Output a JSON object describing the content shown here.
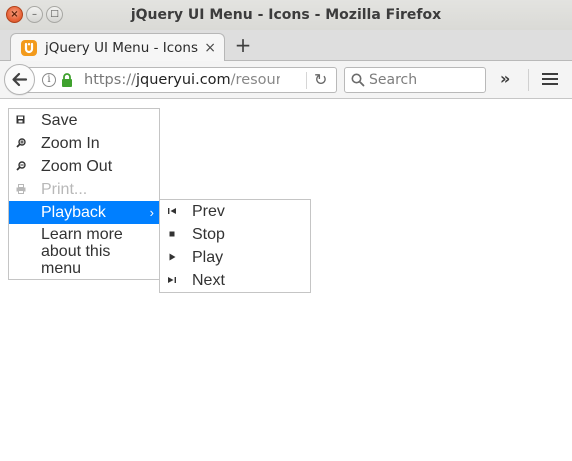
{
  "window": {
    "title": "jQuery UI Menu - Icons - Mozilla Firefox",
    "controls": {
      "close": "×",
      "minimize": "–",
      "maximize": "□"
    }
  },
  "tabs": [
    {
      "title": "jQuery UI Menu - Icons",
      "close": "×",
      "favicon": "jquery-ui-icon"
    }
  ],
  "new_tab": "+",
  "navbar": {
    "url_scheme": "https://",
    "url_host": "jqueryui.com",
    "url_path": "/resources",
    "search_placeholder": "Search",
    "overflow": "»",
    "reload": "↻"
  },
  "menu": {
    "items": [
      {
        "label": "Save",
        "icon": "disk-icon",
        "disabled": false
      },
      {
        "label": "Zoom In",
        "icon": "zoom-in-icon",
        "disabled": false
      },
      {
        "label": "Zoom Out",
        "icon": "zoom-out-icon",
        "disabled": false
      },
      {
        "label": "Print...",
        "icon": "print-icon",
        "disabled": true
      },
      {
        "label": "Playback",
        "icon": "",
        "active": true,
        "has_submenu": true,
        "caret": "›"
      },
      {
        "label": "Learn more about this menu",
        "icon": ""
      }
    ],
    "submenu": {
      "items": [
        {
          "label": "Prev",
          "icon": "seek-start-icon"
        },
        {
          "label": "Stop",
          "icon": "stop-icon"
        },
        {
          "label": "Play",
          "icon": "play-icon"
        },
        {
          "label": "Next",
          "icon": "seek-end-icon"
        }
      ]
    }
  },
  "colors": {
    "active_item": "#007fff",
    "disabled_text": "#b8b8b8",
    "menu_border": "#c5c5c5",
    "title_close": "#e8643a"
  }
}
